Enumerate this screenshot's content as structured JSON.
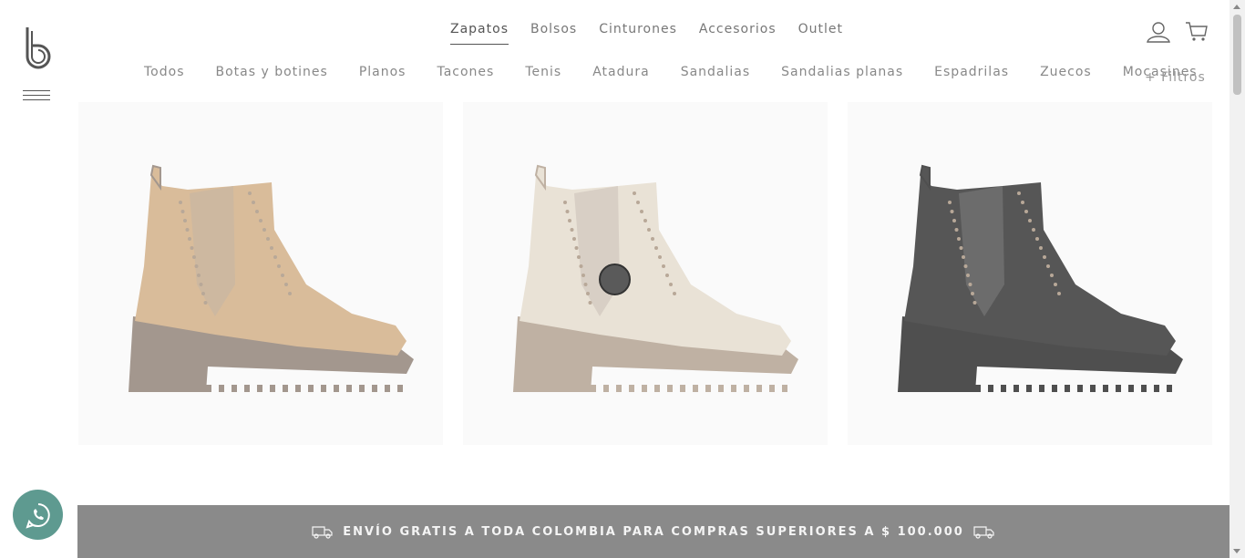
{
  "brand": {
    "logo_icon": "brand-b-logo"
  },
  "top_nav": {
    "items": [
      {
        "label": "Zapatos",
        "active": true
      },
      {
        "label": "Bolsos",
        "active": false
      },
      {
        "label": "Cinturones",
        "active": false
      },
      {
        "label": "Accesorios",
        "active": false
      },
      {
        "label": "Outlet",
        "active": false
      }
    ]
  },
  "header_icons": {
    "account": "user-icon",
    "cart": "cart-icon"
  },
  "sub_nav": {
    "items": [
      {
        "label": "Todos"
      },
      {
        "label": "Botas y botines"
      },
      {
        "label": "Planos"
      },
      {
        "label": "Tacones"
      },
      {
        "label": "Tenis"
      },
      {
        "label": "Atadura"
      },
      {
        "label": "Sandalias"
      },
      {
        "label": "Sandalias planas"
      },
      {
        "label": "Espadrilas"
      },
      {
        "label": "Zuecos"
      },
      {
        "label": "Mocasines"
      }
    ],
    "filters_label": "+ Filtros"
  },
  "products": [
    {
      "color_name": "beige",
      "upper": "#d9bc9a",
      "sole": "#a3978e",
      "elastic": "#cdb8a0"
    },
    {
      "color_name": "cream",
      "upper": "#e9e2d6",
      "sole": "#bfb1a3",
      "elastic": "#d8cfc5"
    },
    {
      "color_name": "black",
      "upper": "#565656",
      "sole": "#4f4f4f",
      "elastic": "#6c6c6c"
    }
  ],
  "banner": {
    "text": "ENVÍO GRATIS A TODA COLOMBIA PARA COMPRAS SUPERIORES A $ 100.000",
    "icon": "truck-icon"
  },
  "whatsapp": {
    "icon": "whatsapp-icon",
    "color": "#5e9a90"
  }
}
